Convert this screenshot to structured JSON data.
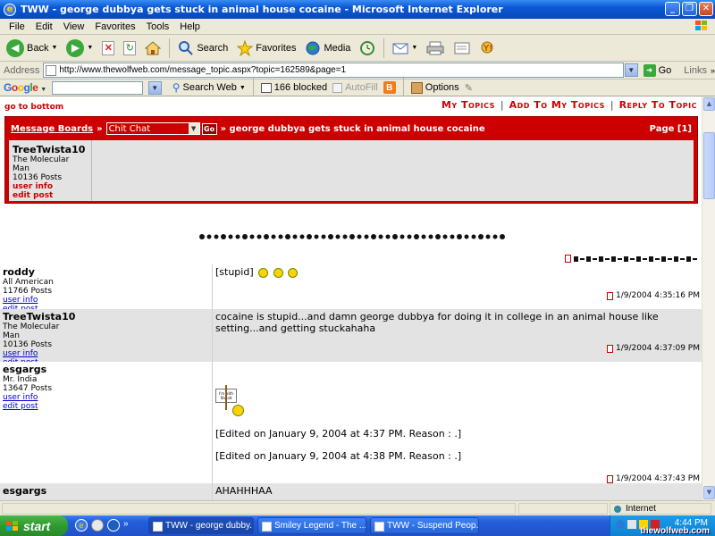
{
  "window": {
    "title": "TWW - george dubbya gets stuck in animal house cocaine - Microsoft Internet Explorer"
  },
  "menu": [
    "File",
    "Edit",
    "View",
    "Favorites",
    "Tools",
    "Help"
  ],
  "toolbar": {
    "back": "Back",
    "search": "Search",
    "favorites": "Favorites",
    "media": "Media"
  },
  "address": {
    "label": "Address",
    "url": "http://www.thewolfweb.com/message_topic.aspx?topic=162589&page=1",
    "go": "Go",
    "links": "Links"
  },
  "googlebar": {
    "logo": "Google",
    "search_web": "Search Web",
    "blocked": "166 blocked",
    "autofill": "AutoFill",
    "options": "Options"
  },
  "page": {
    "go_bottom": "go to bottom",
    "top_links": [
      "My Topics",
      "Add To My Topics",
      "Reply To Topic"
    ],
    "top_sep": "|",
    "breadcrumb": {
      "boards": "Message Boards",
      "arrow": "»",
      "board_select": "Chit Chat",
      "go": "Go",
      "topic": "» george dubbya gets stuck in animal house cocaine",
      "page_label": "Page [1]"
    },
    "op": {
      "name": "TreeTwista10",
      "title1": "The Molecular",
      "title2": "Man",
      "posts": "10136 Posts",
      "user_info": "user info",
      "edit_post": "edit post"
    }
  },
  "posts": [
    {
      "name": "roddy",
      "title": "All American",
      "title2": "",
      "posts": "11766 Posts",
      "user_info": "user info",
      "edit_post": "edit post",
      "body": "[stupid]",
      "stamp": "1/9/2004 4:35:16 PM",
      "bg": "#ffffff"
    },
    {
      "name": "TreeTwista10",
      "title": "The Molecular",
      "title2": "Man",
      "posts": "10136 Posts",
      "user_info": "user info",
      "edit_post": "edit post",
      "body": "cocaine is stupid...and damn george dubbya for doing it in college in an animal house like setting...and getting stuckahaha",
      "stamp": "1/9/2004 4:37:09 PM",
      "bg": "#e3e3e3"
    },
    {
      "name": "esgargs",
      "title": "Mr. India",
      "title2": "",
      "posts": "13647 Posts",
      "user_info": "user info",
      "edit_post": "edit post",
      "body": "",
      "edit1": "[Edited on January 9, 2004 at 4:37 PM. Reason : .]",
      "edit2": "[Edited on January 9, 2004 at 4:38 PM. Reason : .]",
      "sign_text": "I'm with Stupid",
      "stamp": "1/9/2004 4:37:43 PM",
      "bg": "#ffffff"
    },
    {
      "name": "esgargs",
      "title": "",
      "title2": "",
      "posts": "",
      "user_info": "",
      "edit_post": "",
      "body": "AHAHHHAA",
      "stamp": "",
      "bg": "#e3e3e3"
    }
  ],
  "status": {
    "zone": "Internet"
  },
  "taskbar": {
    "start": "start",
    "tasks": [
      "TWW - george dubby...",
      "Smiley Legend - The ...",
      "TWW - Suspend Peop..."
    ],
    "clock": "4:44 PM",
    "watermark": "thewolfweb.com"
  },
  "colors": {
    "accent_red": "#cc0000",
    "post_gray": "#e3e3e3",
    "xp_blue": "#245edb"
  }
}
